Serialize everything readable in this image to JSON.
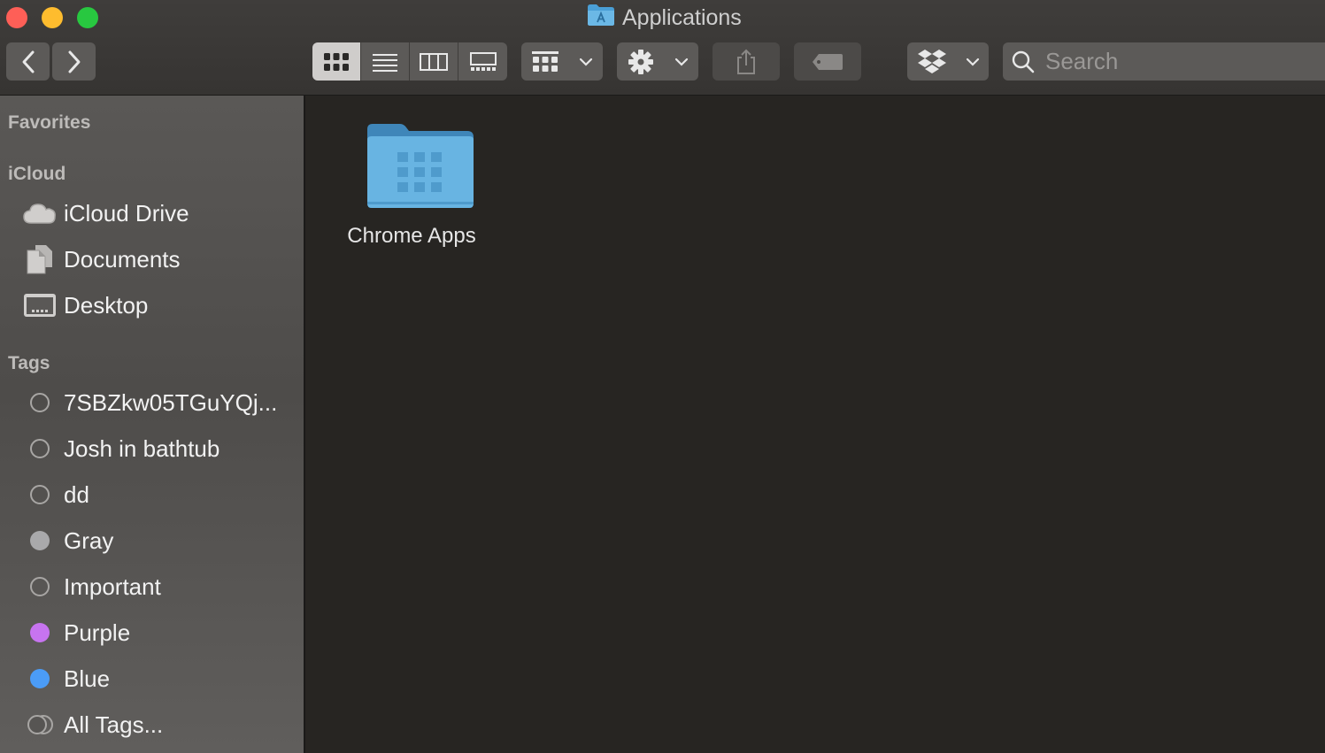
{
  "window": {
    "title": "Applications",
    "colors": {
      "close": "#fe5f57",
      "minimize": "#febc2e",
      "maximize": "#28c840"
    }
  },
  "toolbar": {
    "back_icon": "chevron-left-icon",
    "forward_icon": "chevron-right-icon",
    "view_modes": [
      "icon-view",
      "list-view",
      "column-view",
      "gallery-view"
    ],
    "active_view": "icon-view",
    "search_placeholder": "Search"
  },
  "sidebar": {
    "favorites_header": "Favorites",
    "icloud_header": "iCloud",
    "icloud_items": [
      {
        "label": "iCloud Drive",
        "icon": "cloud-icon"
      },
      {
        "label": "Documents",
        "icon": "documents-icon"
      },
      {
        "label": "Desktop",
        "icon": "desktop-icon"
      }
    ],
    "tags_header": "Tags",
    "tags": [
      {
        "label": "7SBZkw05TGuYQj...",
        "color": ""
      },
      {
        "label": "Josh in bathtub",
        "color": ""
      },
      {
        "label": "dd",
        "color": ""
      },
      {
        "label": "Gray",
        "color": "#a9a9ab"
      },
      {
        "label": "Important",
        "color": ""
      },
      {
        "label": "Purple",
        "color": "#c774f0"
      },
      {
        "label": "Blue",
        "color": "#4b9cf7"
      },
      {
        "label": "All Tags...",
        "color": ""
      }
    ]
  },
  "main": {
    "items": [
      {
        "name": "Chrome Apps",
        "icon": "folder-icon"
      }
    ]
  }
}
